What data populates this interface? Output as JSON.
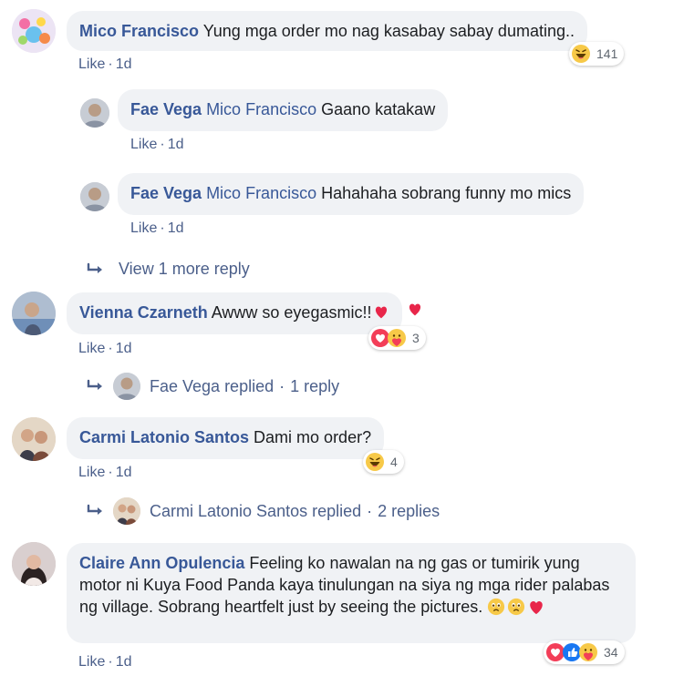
{
  "comments": [
    {
      "author": "Mico Francisco",
      "text": "Yung mga order mo nag kasabay sabay dumating..",
      "like": "Like",
      "time": "1d",
      "reaction_count": "141",
      "reaction_icons": [
        "haha-icon"
      ],
      "replies": [
        {
          "author": "Fae Vega",
          "mention": "Mico Francisco",
          "text": "Gaano katakaw",
          "like": "Like",
          "time": "1d"
        },
        {
          "author": "Fae Vega",
          "mention": "Mico Francisco",
          "text": "Hahahaha sobrang funny mo mics",
          "like": "Like",
          "time": "1d"
        }
      ],
      "more_replies": "View 1 more reply"
    },
    {
      "author": "Vienna Czarneth",
      "text": "Awww so eyegasmic!!",
      "emoji_suffix": "heart-emoji",
      "like": "Like",
      "time": "1d",
      "reaction_count": "3",
      "reaction_icons": [
        "love-icon",
        "care-icon"
      ],
      "replied_summary": {
        "name": "Fae Vega replied",
        "count": "1 reply"
      }
    },
    {
      "author": "Carmi Latonio Santos",
      "text": "Dami mo order?",
      "like": "Like",
      "time": "1d",
      "reaction_count": "4",
      "reaction_icons": [
        "haha-icon"
      ],
      "replied_summary": {
        "name": "Carmi Latonio Santos replied",
        "count": "2 replies"
      }
    },
    {
      "author": "Claire Ann Opulencia",
      "text": "Feeling ko nawalan na ng gas or tumirik yung motor ni Kuya Food Panda kaya tinulungan na siya ng mga rider palabas ng village. Sobrang heartfelt just by seeing the pictures.",
      "emoji_suffix": "sad-sad-heart-emojis",
      "like": "Like",
      "time": "1d",
      "reaction_count": "34",
      "reaction_icons": [
        "love-icon",
        "like-icon",
        "care-icon"
      ]
    }
  ],
  "separator": "·",
  "colors": {
    "link": "#385898",
    "meta": "#4b5f8a",
    "bubble": "#f0f2f5"
  }
}
